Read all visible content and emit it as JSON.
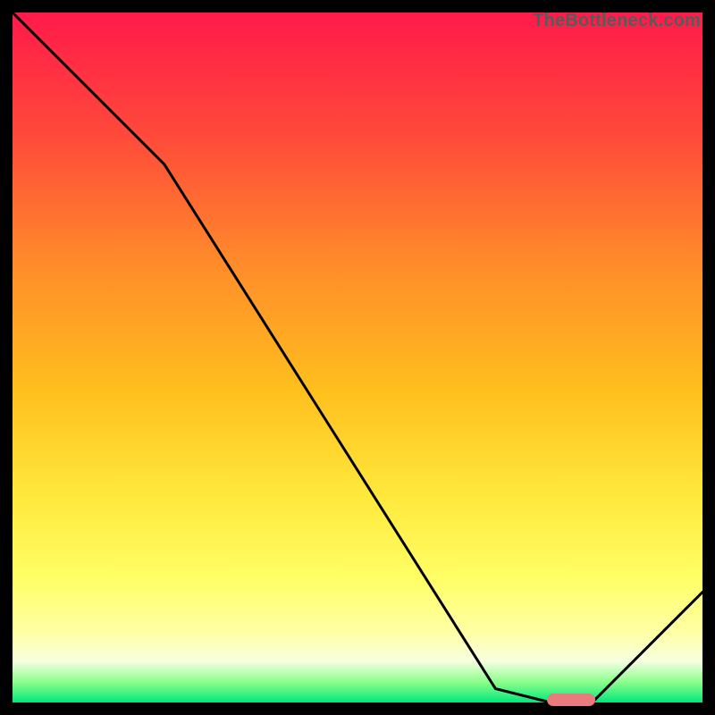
{
  "watermark": "TheBottleneck.com",
  "chart_data": {
    "type": "line",
    "title": "",
    "xlabel": "",
    "ylabel": "",
    "xlim": [
      0,
      100
    ],
    "ylim": [
      0,
      100
    ],
    "grid": false,
    "series": [
      {
        "name": "bottleneck-curve",
        "x": [
          0,
          22,
          70,
          78,
          84,
          100
        ],
        "values": [
          100,
          78,
          2,
          0,
          0,
          16
        ]
      }
    ],
    "annotations": [
      {
        "name": "optimal-range-marker",
        "x_start": 78,
        "x_end": 84,
        "y": 0,
        "color": "#e97b7f"
      }
    ],
    "gradient_stops": [
      {
        "pos": 0,
        "color": "#ff1a4a"
      },
      {
        "pos": 18,
        "color": "#ff4a3a"
      },
      {
        "pos": 36,
        "color": "#ff8a2a"
      },
      {
        "pos": 55,
        "color": "#ffc01e"
      },
      {
        "pos": 70,
        "color": "#ffe83c"
      },
      {
        "pos": 82,
        "color": "#ffff66"
      },
      {
        "pos": 90,
        "color": "#ffffa8"
      },
      {
        "pos": 94,
        "color": "#f6ffe0"
      },
      {
        "pos": 97,
        "color": "#8cff8c"
      },
      {
        "pos": 100,
        "color": "#00e87a"
      }
    ]
  }
}
